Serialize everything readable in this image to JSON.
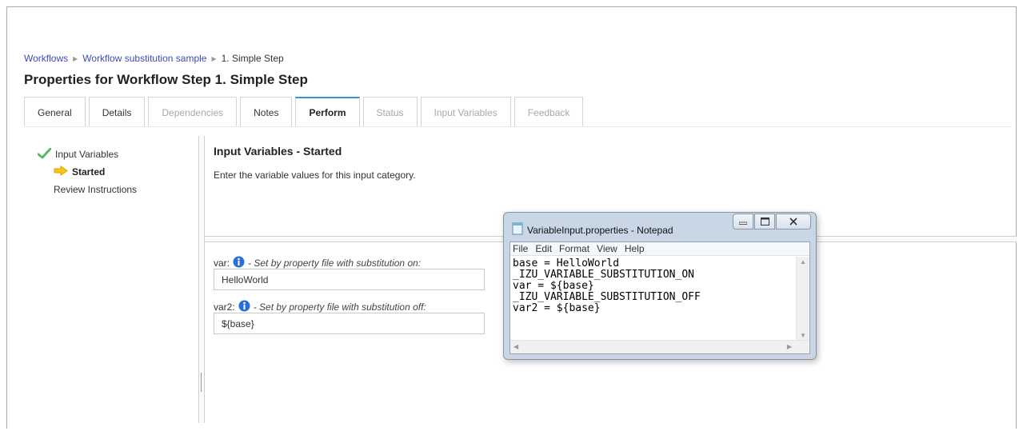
{
  "breadcrumb": {
    "workflows": "Workflows",
    "workflow": "Workflow substitution sample",
    "step": "1. Simple Step"
  },
  "page_title": "Properties for Workflow Step 1. Simple Step",
  "tabs": [
    {
      "label": "General",
      "state": "normal"
    },
    {
      "label": "Details",
      "state": "normal"
    },
    {
      "label": "Dependencies",
      "state": "disabled"
    },
    {
      "label": "Notes",
      "state": "normal"
    },
    {
      "label": "Perform",
      "state": "active"
    },
    {
      "label": "Status",
      "state": "disabled"
    },
    {
      "label": "Input Variables",
      "state": "disabled"
    },
    {
      "label": "Feedback",
      "state": "disabled"
    }
  ],
  "nav": {
    "input_variables": "Input Variables",
    "started": "Started",
    "review": "Review Instructions"
  },
  "section": {
    "title": "Input Variables - Started",
    "description": "Enter the variable values for this input category."
  },
  "fields": [
    {
      "name": "var:",
      "note": "- Set by property file with substitution on:",
      "value": "HelloWorld"
    },
    {
      "name": "var2:",
      "note": "- Set by property file with substitution off:",
      "value": "${base}"
    }
  ],
  "notepad": {
    "title": "VariableInput.properties - Notepad",
    "menu": [
      "File",
      "Edit",
      "Format",
      "View",
      "Help"
    ],
    "content": "base = HelloWorld\n_IZU_VARIABLE_SUBSTITUTION_ON\nvar = ${base}\n_IZU_VARIABLE_SUBSTITUTION_OFF\nvar2 = ${base}"
  },
  "colors": {
    "link": "#3c4bb0",
    "active_tab_accent": "#3c8fd4",
    "check": "#5cb85c",
    "arrow": "#f5c518",
    "info": "#2a6fd6"
  }
}
